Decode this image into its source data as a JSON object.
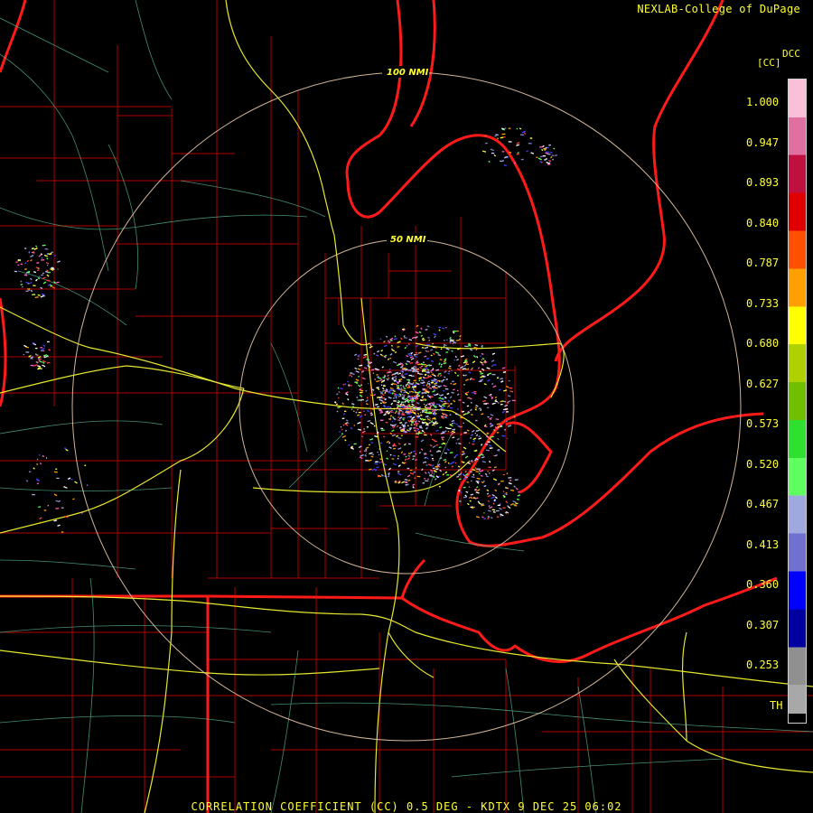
{
  "header": {
    "credit": "NEXLAB-College of DuPage"
  },
  "legend": {
    "product_code": "DCC",
    "unit": "[CC]",
    "ticks": [
      "1.000",
      "0.947",
      "0.893",
      "0.840",
      "0.787",
      "0.733",
      "0.680",
      "0.627",
      "0.573",
      "0.520",
      "0.467",
      "0.413",
      "0.360",
      "0.307",
      "0.253",
      "TH"
    ],
    "colors_top_to_bottom": [
      "#f9c0d8",
      "#e070a0",
      "#c01040",
      "#e00000",
      "#ff5000",
      "#ffa000",
      "#ffff00",
      "#b0d000",
      "#70c000",
      "#30e030",
      "#60ff60",
      "#a0a8e0",
      "#7070d0",
      "#0000ff",
      "#0000a0",
      "#909090",
      "#a8a8a8"
    ]
  },
  "range_rings": [
    {
      "label": "100 NMI"
    },
    {
      "label": "50 NMI"
    }
  ],
  "footer": {
    "caption": "CORRELATION COEFFICIENT (CC) 0.5 DEG - KDTX 9 DEC 25 06:02"
  }
}
